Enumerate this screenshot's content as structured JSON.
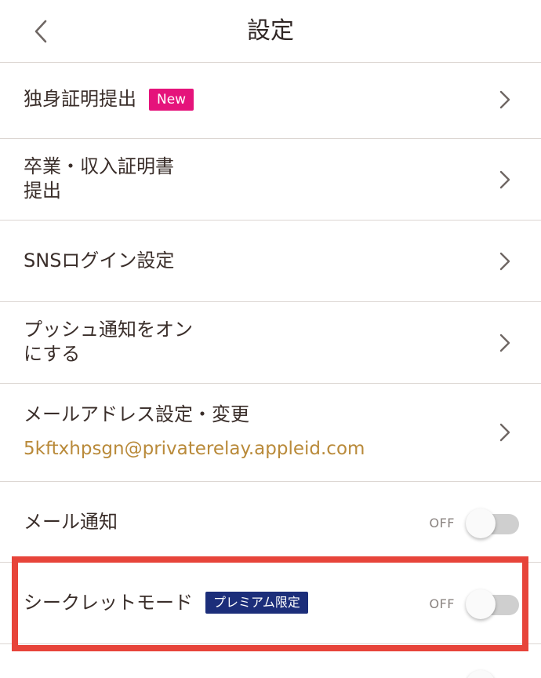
{
  "header": {
    "title": "設定",
    "back_icon": "chevron-left-icon"
  },
  "rows": [
    {
      "label": "独身証明提出",
      "badge": "New",
      "badge_color": "#e5137b"
    },
    {
      "label_line1": "卒業・収入証明書",
      "label_line2": "提出"
    },
    {
      "label": "SNSログイン設定"
    },
    {
      "label_line1": "プッシュ通知をオン",
      "label_line2": "にする"
    },
    {
      "label": "メールアドレス設定・変更",
      "email": "5kftxhpsgn@privaterelay.appleid.com",
      "email_color": "#b98a3a"
    },
    {
      "label": "メール通知",
      "toggle_state": "OFF",
      "toggle_on": false
    },
    {
      "label": "シークレットモード",
      "badge": "プレミアム限定",
      "badge_color": "#1c2e7a",
      "toggle_state": "OFF",
      "toggle_on": false
    }
  ],
  "highlight_color": "#e7443a",
  "accent_colors": {
    "divider": "#dcd6d2",
    "text": "#3a2e2a"
  }
}
